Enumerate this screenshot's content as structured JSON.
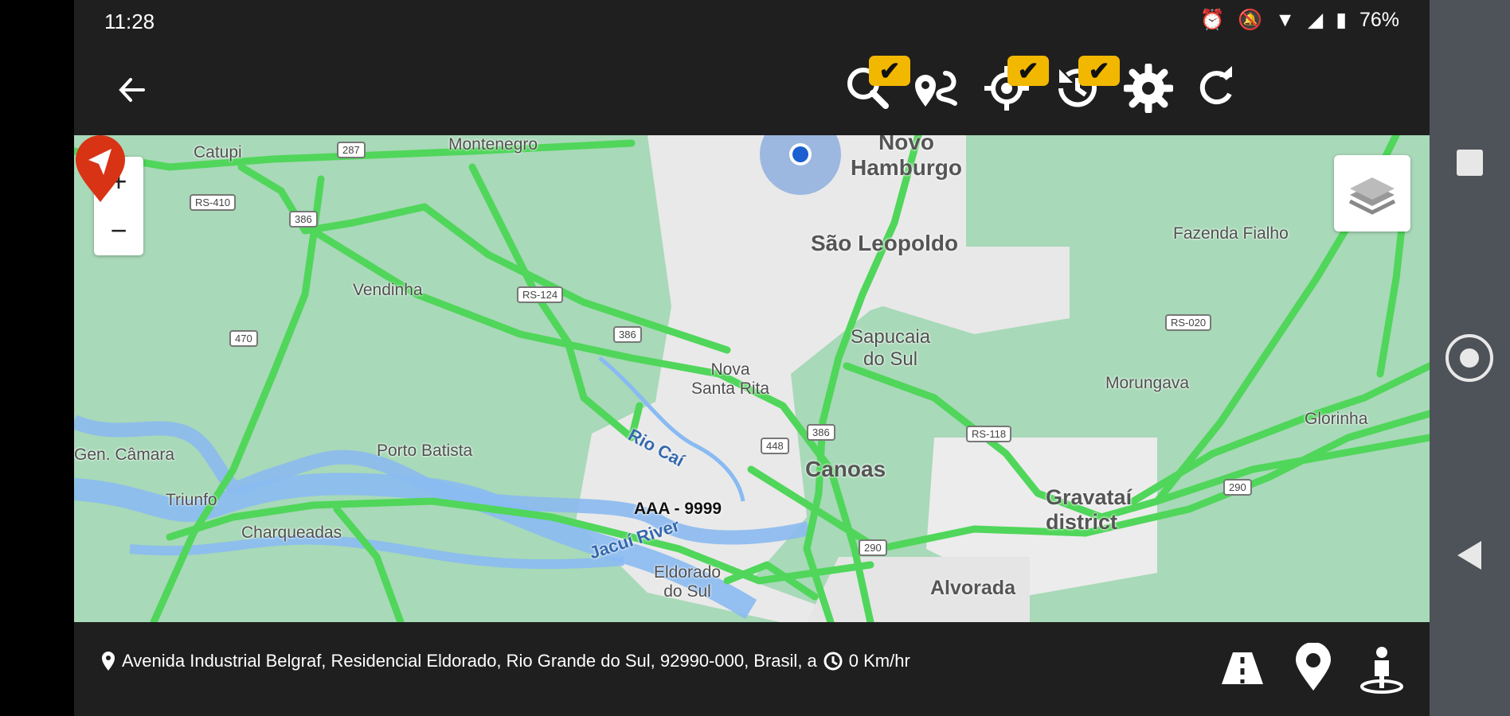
{
  "status_bar": {
    "time": "11:28",
    "battery": "76%"
  },
  "toolbar": {
    "badge_check": "✔",
    "icons": [
      "back-arrow-icon",
      "search-icon",
      "route-icon",
      "crosshair-icon",
      "history-icon",
      "gear-icon",
      "refresh-icon"
    ],
    "badge_color": "#f2b800"
  },
  "map": {
    "zoom_in": "+",
    "zoom_out": "−",
    "labels": {
      "catupi": "Catupi",
      "montenegro": "Montenegro",
      "novo_hamburgo": "Novo\nHamburgo",
      "sao_leopoldo": "São Leopoldo",
      "fazenda_fialho": "Fazenda Fialho",
      "vendinha": "Vendinha",
      "sapucaia": "Sapucaia\ndo Sul",
      "nova_santa_rita": "Nova\nSanta Rita",
      "morungava": "Morungava",
      "gloria": "Glorinha",
      "gen_camara": "Gen. Câmara",
      "porto_batista": "Porto Batista",
      "rio_cai": "Rio Caí",
      "canoas": "Canoas",
      "gravatai": "Gravataí\ndistrict",
      "triunfo": "Triunfo",
      "charqueadas": "Charqueadas",
      "jacui_river": "Jacuí River",
      "eldorado": "Eldorado\ndo Sul",
      "alvorada": "Alvorada"
    },
    "roads": {
      "r287": "287",
      "r386a": "386",
      "r386b": "386",
      "r386c": "386",
      "r470": "470",
      "r448": "448",
      "r290a": "290",
      "r290b": "290",
      "rs410": "RS-410",
      "rs124": "RS-124",
      "rs118": "RS-118",
      "rs020": "RS-020"
    },
    "vehicle_plate": "AAA - 9999",
    "marker_color": "#d83315",
    "location_circle_color": "#5d8fd8"
  },
  "footer": {
    "address": "Avenida Industrial Belgraf, Residencial Eldorado, Rio Grande do Sul, 92990-000, Brasil, a",
    "speed": "0 Km/hr",
    "icons": [
      "location-pin-icon",
      "speed-clock-icon",
      "road-icon",
      "map-pin-icon",
      "street-view-icon"
    ]
  },
  "nav": {
    "icons": [
      "recents-square-icon",
      "home-circle-icon",
      "back-triangle-icon"
    ]
  }
}
